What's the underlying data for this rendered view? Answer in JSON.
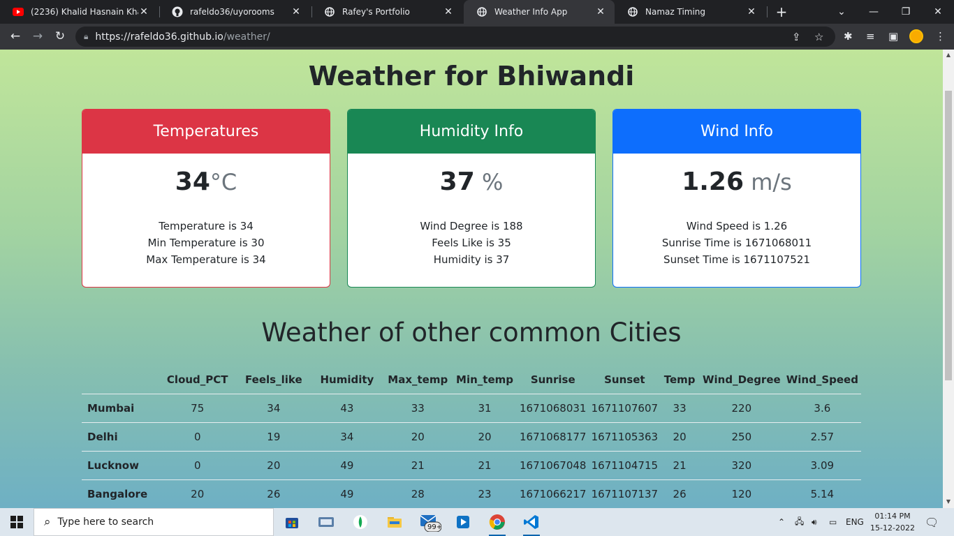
{
  "browser": {
    "tabs": [
      {
        "title": "(2236) Khalid Hasnain Khalid",
        "icon": "youtube-icon",
        "active": false
      },
      {
        "title": "rafeldo36/uyorooms",
        "icon": "github-icon",
        "active": false
      },
      {
        "title": "Rafey's Portfolio",
        "icon": "globe-icon",
        "active": false
      },
      {
        "title": "Weather Info App",
        "icon": "globe-icon",
        "active": true
      },
      {
        "title": "Namaz Timing",
        "icon": "globe-icon",
        "active": false
      }
    ],
    "url_host": "https://rafeldo36.github.io",
    "url_path": "/weather/"
  },
  "page": {
    "title": "Weather for Bhiwandi",
    "cards": {
      "temperature": {
        "header": "Temperatures",
        "value": "34",
        "unit": "°C",
        "lines": [
          "Temperature is 34",
          "Min Temperature is 30",
          "Max Temperature is 34"
        ]
      },
      "humidity": {
        "header": "Humidity Info",
        "value": "37",
        "unit": " %",
        "lines": [
          "Wind Degree is 188",
          "Feels Like is 35",
          "Humidity is 37"
        ]
      },
      "wind": {
        "header": "Wind Info",
        "value": "1.26",
        "unit": " m/s",
        "lines": [
          "Wind Speed is 1.26",
          "Sunrise Time is 1671068011",
          "Sunset Time is 1671107521"
        ]
      }
    },
    "cities_title": "Weather of other common Cities",
    "table": {
      "columns": [
        "Cloud_PCT",
        "Feels_like",
        "Humidity",
        "Max_temp",
        "Min_temp",
        "Sunrise",
        "Sunset",
        "Temp",
        "Wind_Degree",
        "Wind_Speed"
      ],
      "rows": [
        {
          "city": "Mumbai",
          "cells": [
            "75",
            "34",
            "43",
            "33",
            "31",
            "1671068031",
            "1671107607",
            "33",
            "220",
            "3.6"
          ]
        },
        {
          "city": "Delhi",
          "cells": [
            "0",
            "19",
            "34",
            "20",
            "20",
            "1671068177",
            "1671105363",
            "20",
            "250",
            "2.57"
          ]
        },
        {
          "city": "Lucknow",
          "cells": [
            "0",
            "20",
            "49",
            "21",
            "21",
            "1671067048",
            "1671104715",
            "21",
            "320",
            "3.09"
          ]
        },
        {
          "city": "Bangalore",
          "cells": [
            "20",
            "26",
            "49",
            "28",
            "23",
            "1671066217",
            "1671107137",
            "26",
            "120",
            "5.14"
          ]
        }
      ]
    }
  },
  "taskbar": {
    "search_placeholder": "Type here to search",
    "mail_badge": "99+",
    "language": "ENG",
    "time": "01:14 PM",
    "date": "15-12-2022"
  },
  "colors": {
    "temp_header": "#dc3545",
    "humidity_header": "#198754",
    "wind_header": "#0d6efd"
  }
}
